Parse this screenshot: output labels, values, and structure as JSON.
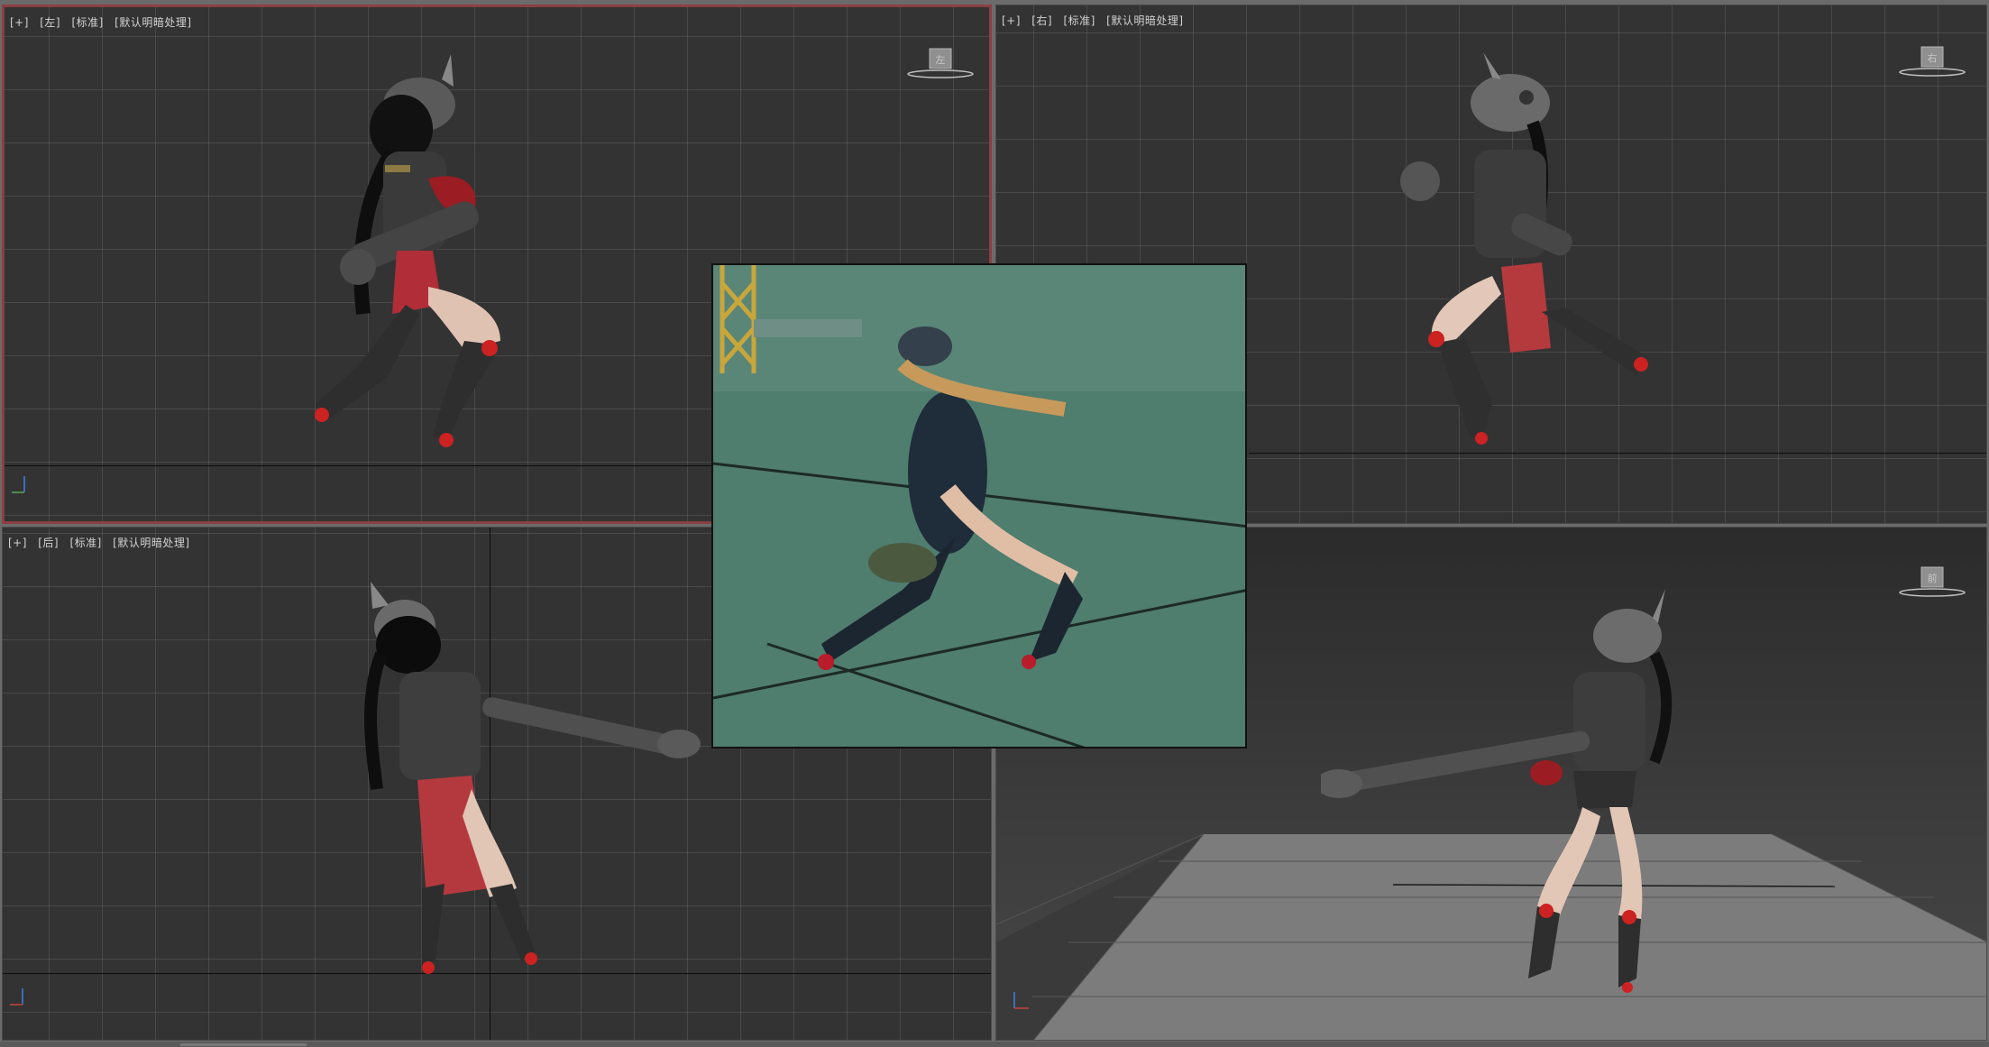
{
  "viewports": {
    "left": {
      "plus": "[+]",
      "view": "[左]",
      "shading": "[标准]",
      "lighting": "[默认明暗处理]"
    },
    "right": {
      "plus": "[+]",
      "view": "[右]",
      "shading": "[标准]",
      "lighting": "[默认明暗处理]"
    },
    "back": {
      "plus": "[+]",
      "view": "[后]",
      "shading": "[标准]",
      "lighting": "[默认明暗处理]"
    },
    "perspective": {
      "viewcube_face": "前"
    }
  },
  "viewcube_faces": {
    "left": "左",
    "right": "右"
  },
  "colors": {
    "active_viewport_border": "#8b3f42",
    "viewport_bg": "#333333",
    "reference_bg": "#5f8b7d"
  },
  "icons": {
    "axis_gizmo": "axis-tripod-icon",
    "viewcube": "viewcube-icon"
  }
}
